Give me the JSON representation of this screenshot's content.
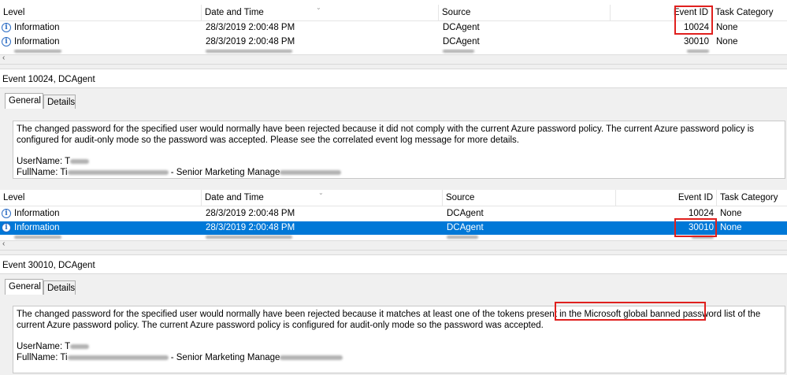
{
  "columns": {
    "level": "Level",
    "datetime": "Date and Time",
    "source": "Source",
    "event_id": "Event ID",
    "task_category": "Task Category"
  },
  "panel1": {
    "rows": [
      {
        "level": "Information",
        "datetime": "28/3/2019 2:00:48 PM",
        "source": "DCAgent",
        "event_id": "10024",
        "task": "None"
      },
      {
        "level": "Information",
        "datetime": "28/3/2019 2:00:48 PM",
        "source": "DCAgent",
        "event_id": "30010",
        "task": "None"
      }
    ],
    "event_title": "Event 10024, DCAgent",
    "tabs": {
      "general": "General",
      "details": "Details"
    },
    "description": "The changed password for the specified user would normally have been rejected because it did not comply with the current Azure password policy. The current Azure password policy is configured for audit-only mode so the password was accepted. Please see the correlated event log message for more details.",
    "username_label": "UserName: T",
    "fullname_label": "FullName: Ti",
    "fullname_mid": " - Senior Marketing Manage"
  },
  "panel2": {
    "rows": [
      {
        "level": "Information",
        "datetime": "28/3/2019 2:00:48 PM",
        "source": "DCAgent",
        "event_id": "10024",
        "task": "None"
      },
      {
        "level": "Information",
        "datetime": "28/3/2019 2:00:48 PM",
        "source": "DCAgent",
        "event_id": "30010",
        "task": "None"
      }
    ],
    "event_title": "Event 30010, DCAgent",
    "tabs": {
      "general": "General",
      "details": "Details"
    },
    "description_before": "The changed password for the specified user would normally have been rejected because it matches at least one of the tokens present in the ",
    "description_highlight": "Microsoft global banned password list",
    "description_after": " of the current Azure password policy. The current Azure password policy is configured for audit-only mode so the password was accepted.",
    "username_label": "UserName: T",
    "fullname_label": "FullName: Ti",
    "fullname_mid": " - Senior Marketing Manage"
  },
  "icons": {
    "info": "information-icon",
    "scroll_left": "scroll-left-arrow-icon",
    "sort": "sort-arrow-icon"
  },
  "colors": {
    "selection": "#0078d7",
    "highlight_box": "#e0201e",
    "info_icon": "#2b6cc4"
  }
}
